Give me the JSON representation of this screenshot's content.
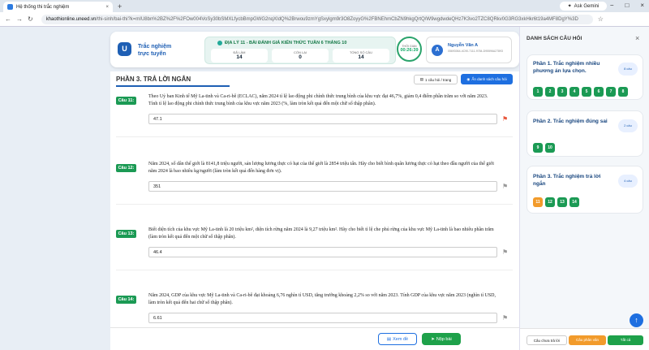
{
  "browser": {
    "tab_title": "Hệ thống thi trắc nghiệm",
    "new_tab": "+",
    "gemini_label": "Ask Gemini",
    "url_domain": "khaothionline.uneed.vn",
    "url_path": "/thi-sinh/bai-thi?k=mIU8bn%2BZ%2F%2FOw004VoSy30bSMXLfycbBmpGWG2nqXIdQ%2Brwou9zmYgSxylgm9r3O8ZoyyG%2FBNEhmCbZN9hkgQrtQ/W9wgdwdeQHz7K3vo2TZC8QRkv0G3RG3xkHkr6t19a4MF8DgY%3D"
  },
  "header": {
    "brand_line1": "Trắc nghiệm",
    "brand_line2": "trực tuyến",
    "exam_title": "ĐỊA LÝ 11 - BÀI ĐÁNH GIÁ KIẾN THỨC TUẦN 6 THÁNG 10",
    "stats": [
      {
        "label": "ĐÃ LÀM",
        "value": "14"
      },
      {
        "label": "CÒN LẠI",
        "value": "0"
      },
      {
        "label": "TỔNG SỐ CÂU",
        "value": "14"
      }
    ],
    "timer_label": "THỜI GIAN",
    "timer_value": "00:26:39",
    "user_initial": "A",
    "user_name": "Nguyễn Văn A",
    "user_id": "05693064-4C90-7111-9784-D95596A27893"
  },
  "section": {
    "title": "PHẦN 3. TRẢ LỜI NGẮN",
    "per_page_label": "1 câu hỏi / trang",
    "hide_list_label": "Ẩn danh sách câu hỏi"
  },
  "questions": [
    {
      "badge": "Câu 11:",
      "text": "Theo Uỷ ban Kinh tế Mỹ La-tinh và Ca-ri-bê (ECLAC), năm 2024 tỉ lệ lao động phi chính thức trung bình của khu vực đạt 46,7%, giảm 0,4 điểm phần trăm so với năm 2023. Tính tỉ lệ lao động phi chính thức trung bình của khu vực năm 2023 (%, làm tròn kết quả đến một chữ số thập phân).",
      "answer": "47.1"
    },
    {
      "badge": "Câu 12:",
      "text": "Năm 2024, số dân thế giới là 8141,8 triệu người, sản lượng lương thực có hạt của thế giới là 2854 triệu tấn. Hãy cho biết bình quân lương thực có hạt theo đầu người của thế giới năm 2024 là bao nhiêu kg/người (làm tròn kết quả đến hàng đơn vị).",
      "answer": "351"
    },
    {
      "badge": "Câu 13:",
      "text": "Biết diện tích của khu vực Mỹ La-tinh là 20 triệu km², diện tích rừng năm 2024 là 9,27 triệu km². Hãy cho biết tỉ lệ che phủ rừng của khu vực Mỹ La-tinh là bao nhiêu phần trăm (làm tròn kết quả đến một chữ số thập phân).",
      "answer": "46.4"
    },
    {
      "badge": "Câu 14:",
      "text": "Năm 2024, GDP của khu vực Mỹ La-tinh và Ca-ri-bê đạt khoảng 6,76 nghìn tỉ USD, tăng trưởng khoảng 2,2% so với năm 2023. Tính GDP của khu vực năm 2023 (nghìn tỉ USD, làm tròn kết quả đến hai chữ số thập phân).",
      "answer": "6.61"
    }
  ],
  "footer": {
    "view_label": "Xem đề",
    "submit_label": "Nộp bài"
  },
  "panel": {
    "title": "DANH SÁCH CÂU HỎI",
    "close": "×",
    "groups": [
      {
        "title": "Phần 1. Trắc nghiệm nhiều phương án lựa chọn.",
        "count": "8 câu",
        "nums": [
          "1",
          "2",
          "3",
          "4",
          "5",
          "6",
          "7",
          "8"
        ]
      },
      {
        "title": "Phần 2. Trắc nghiệm đúng sai",
        "count": "2 câu",
        "nums": [
          "9",
          "10"
        ]
      },
      {
        "title": "Phần 3. Trắc nghiệm trả lời ngắn",
        "count": "4 câu",
        "nums": [
          "11",
          "12",
          "13",
          "14"
        ]
      }
    ],
    "btn_unanswered": "Câu chưa trả lời",
    "btn_review": "Câu phân vân",
    "btn_all": "Tất cả"
  },
  "colors": {
    "accent": "#1e6fe0",
    "answered": "#1b9a54",
    "current": "#f29b2b"
  }
}
